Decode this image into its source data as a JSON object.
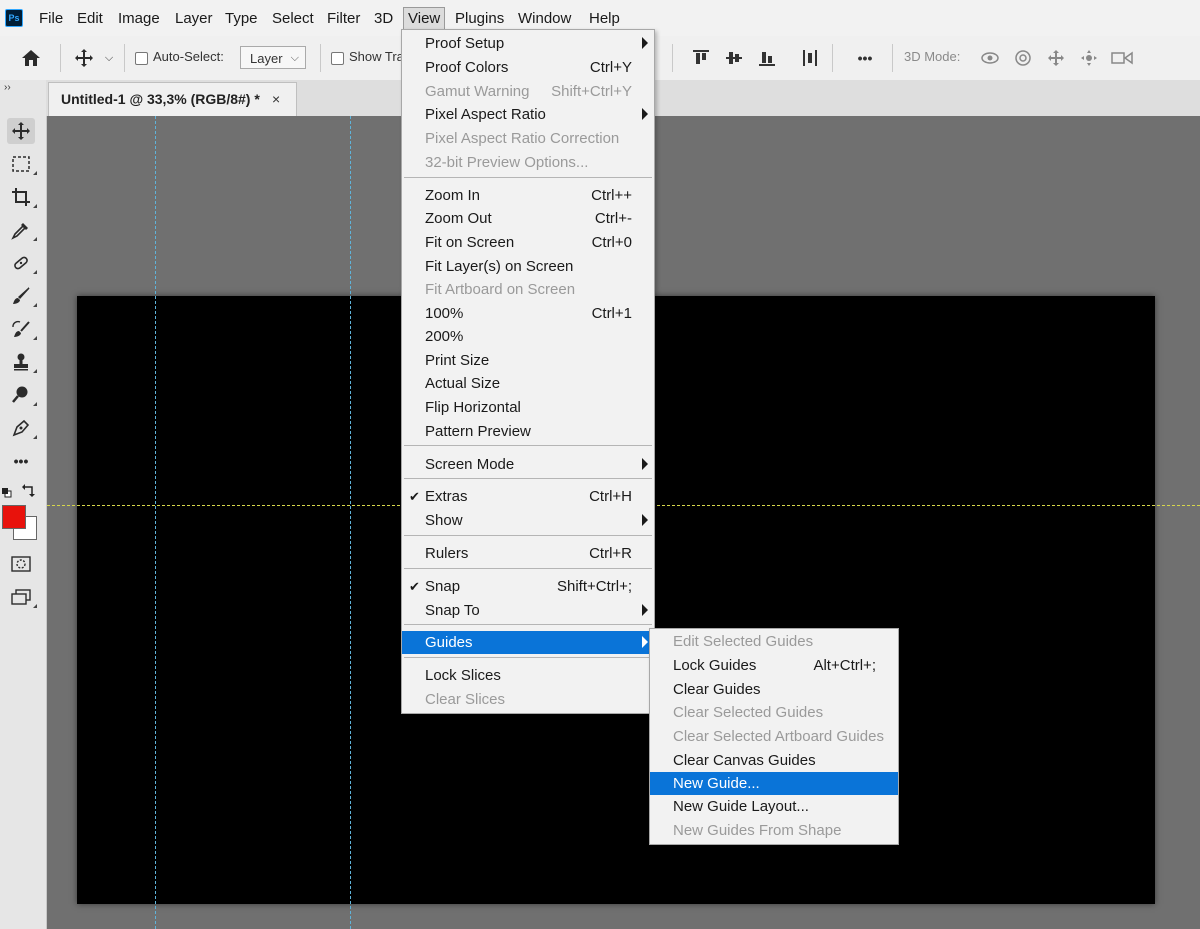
{
  "app": {
    "logo": "Ps"
  },
  "menubar": {
    "items": [
      "File",
      "Edit",
      "Image",
      "Layer",
      "Type",
      "Select",
      "Filter",
      "3D",
      "View",
      "Plugins",
      "Window",
      "Help"
    ],
    "active": "View"
  },
  "options_bar": {
    "auto_select_label": "Auto-Select:",
    "layer_select_value": "Layer",
    "show_transform_label": "Show Tra",
    "mode_3d_label": "3D Mode:",
    "more_label": "•••"
  },
  "document": {
    "tab_title": "Untitled-1 @ 33,3% (RGB/8#) *",
    "close_glyph": "×"
  },
  "toolbar": {
    "collapse_glyph": "››",
    "more_tools_glyph": "•••",
    "foreground_color": "#e8120c",
    "background_color": "#ffffff"
  },
  "colors": {
    "highlight": "#0a74d8",
    "menu_bg": "#f2f2f2",
    "canvas": "#000000",
    "guide_vertical": "#5fb3d9",
    "guide_horizontal": "#d6d64a"
  },
  "view_menu": {
    "items": [
      {
        "label": "Proof Setup",
        "shortcut": "",
        "disabled": false,
        "submenu": true,
        "checked": false
      },
      {
        "label": "Proof Colors",
        "shortcut": "Ctrl+Y",
        "disabled": false,
        "submenu": false,
        "checked": false
      },
      {
        "label": "Gamut Warning",
        "shortcut": "Shift+Ctrl+Y",
        "disabled": true,
        "submenu": false,
        "checked": false
      },
      {
        "label": "Pixel Aspect Ratio",
        "shortcut": "",
        "disabled": false,
        "submenu": true,
        "checked": false
      },
      {
        "label": "Pixel Aspect Ratio Correction",
        "shortcut": "",
        "disabled": true,
        "submenu": false,
        "checked": false
      },
      {
        "label": "32-bit Preview Options...",
        "shortcut": "",
        "disabled": true,
        "submenu": false,
        "checked": false
      },
      {
        "label": "Zoom In",
        "shortcut": "Ctrl++",
        "disabled": false,
        "submenu": false,
        "checked": false
      },
      {
        "label": "Zoom Out",
        "shortcut": "Ctrl+-",
        "disabled": false,
        "submenu": false,
        "checked": false
      },
      {
        "label": "Fit on Screen",
        "shortcut": "Ctrl+0",
        "disabled": false,
        "submenu": false,
        "checked": false
      },
      {
        "label": "Fit Layer(s) on Screen",
        "shortcut": "",
        "disabled": false,
        "submenu": false,
        "checked": false
      },
      {
        "label": "Fit Artboard on Screen",
        "shortcut": "",
        "disabled": true,
        "submenu": false,
        "checked": false
      },
      {
        "label": "100%",
        "shortcut": "Ctrl+1",
        "disabled": false,
        "submenu": false,
        "checked": false
      },
      {
        "label": "200%",
        "shortcut": "",
        "disabled": false,
        "submenu": false,
        "checked": false
      },
      {
        "label": "Print Size",
        "shortcut": "",
        "disabled": false,
        "submenu": false,
        "checked": false
      },
      {
        "label": "Actual Size",
        "shortcut": "",
        "disabled": false,
        "submenu": false,
        "checked": false
      },
      {
        "label": "Flip Horizontal",
        "shortcut": "",
        "disabled": false,
        "submenu": false,
        "checked": false
      },
      {
        "label": "Pattern Preview",
        "shortcut": "",
        "disabled": false,
        "submenu": false,
        "checked": false
      },
      {
        "label": "Screen Mode",
        "shortcut": "",
        "disabled": false,
        "submenu": true,
        "checked": false
      },
      {
        "label": "Extras",
        "shortcut": "Ctrl+H",
        "disabled": false,
        "submenu": false,
        "checked": true
      },
      {
        "label": "Show",
        "shortcut": "",
        "disabled": false,
        "submenu": true,
        "checked": false
      },
      {
        "label": "Rulers",
        "shortcut": "Ctrl+R",
        "disabled": false,
        "submenu": false,
        "checked": false
      },
      {
        "label": "Snap",
        "shortcut": "Shift+Ctrl+;",
        "disabled": false,
        "submenu": false,
        "checked": true
      },
      {
        "label": "Snap To",
        "shortcut": "",
        "disabled": false,
        "submenu": true,
        "checked": false
      },
      {
        "label": "Guides",
        "shortcut": "",
        "disabled": false,
        "submenu": true,
        "checked": false,
        "highlighted": true
      },
      {
        "label": "Lock Slices",
        "shortcut": "",
        "disabled": false,
        "submenu": false,
        "checked": false
      },
      {
        "label": "Clear Slices",
        "shortcut": "",
        "disabled": true,
        "submenu": false,
        "checked": false
      }
    ]
  },
  "guides_submenu": {
    "items": [
      {
        "label": "Edit Selected Guides",
        "shortcut": "",
        "disabled": true
      },
      {
        "label": "Lock Guides",
        "shortcut": "Alt+Ctrl+;",
        "disabled": false
      },
      {
        "label": "Clear Guides",
        "shortcut": "",
        "disabled": false
      },
      {
        "label": "Clear Selected Guides",
        "shortcut": "",
        "disabled": true
      },
      {
        "label": "Clear Selected Artboard Guides",
        "shortcut": "",
        "disabled": true
      },
      {
        "label": "Clear Canvas Guides",
        "shortcut": "",
        "disabled": false
      },
      {
        "label": "New Guide...",
        "shortcut": "",
        "disabled": false,
        "highlighted": true
      },
      {
        "label": "New Guide Layout...",
        "shortcut": "",
        "disabled": false
      },
      {
        "label": "New Guides From Shape",
        "shortcut": "",
        "disabled": true
      }
    ]
  }
}
